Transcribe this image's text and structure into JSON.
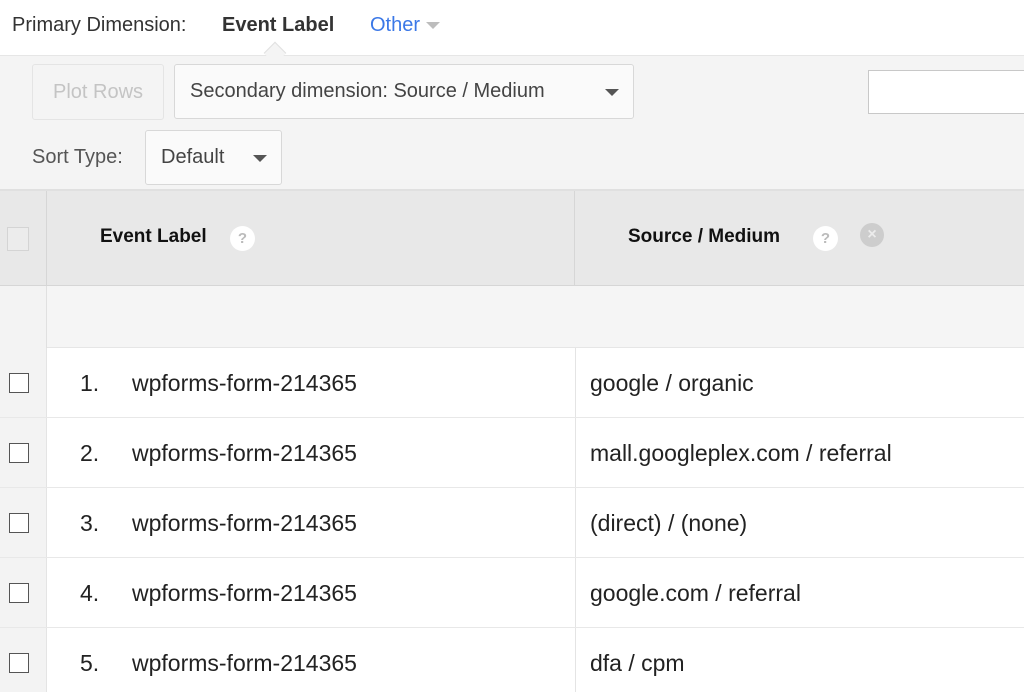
{
  "primary_dimension": {
    "label": "Primary Dimension:",
    "value": "Event Label",
    "other_label": "Other"
  },
  "controls": {
    "plot_rows_label": "Plot Rows",
    "secondary_dimension_label": "Secondary dimension: Source / Medium",
    "sort_type_label": "Sort Type:",
    "sort_type_value": "Default",
    "search_value": ""
  },
  "table": {
    "headers": {
      "col1": "Event Label",
      "col2": "Source / Medium",
      "help_glyph": "?",
      "remove_glyph": "×"
    },
    "rows": [
      {
        "num": "1.",
        "event_label": "wpforms-form-214365",
        "source_medium": "google / organic"
      },
      {
        "num": "2.",
        "event_label": "wpforms-form-214365",
        "source_medium": "mall.googleplex.com / referral"
      },
      {
        "num": "3.",
        "event_label": "wpforms-form-214365",
        "source_medium": "(direct) / (none)"
      },
      {
        "num": "4.",
        "event_label": "wpforms-form-214365",
        "source_medium": "google.com / referral"
      },
      {
        "num": "5.",
        "event_label": "wpforms-form-214365",
        "source_medium": "dfa / cpm"
      }
    ]
  },
  "colors": {
    "link": "#3b78e7",
    "header_bg": "#e8e8e8",
    "controls_bg": "#f4f4f4"
  }
}
